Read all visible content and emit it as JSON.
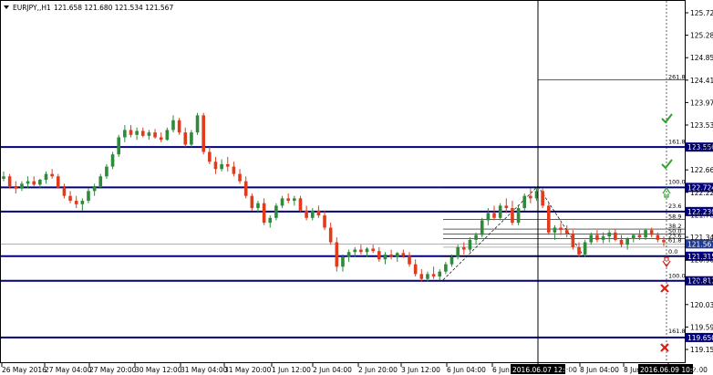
{
  "header": {
    "symbol": "EURJPY,,H1",
    "ohlc": "121.658 121.680 121.534 121.567"
  },
  "colors": {
    "axis": "#000000",
    "level_line": "#000080",
    "bull": "#2e8b3a",
    "bear": "#e23b1c",
    "price_tag": "#000080",
    "current_tag": "#1f3a93",
    "check": "#2aa52a",
    "cross": "#d9231a"
  },
  "chart_data": {
    "type": "candlestick",
    "ylim": [
      119.2,
      126.3
    ],
    "y_ticks": [
      "125.720",
      "125.280",
      "124.850",
      "124.410",
      "123.970",
      "123.530",
      "123.090",
      "122.660",
      "122.220",
      "121.780",
      "121.340",
      "120.900",
      "120.470",
      "120.030",
      "119.590",
      "119.150"
    ],
    "x_ticks": [
      "26 May 2016",
      "27 May 04:00",
      "27 May 20:00",
      "30 May 12:00",
      "31 May 04:00",
      "31 May 20:00",
      "1 Jun 12:00",
      "2 Jun 04:00",
      "2 Jun 20:00",
      "3 Jun 12:00",
      "6 Jun 04:00",
      "6 Jun 20:00",
      "7 Jun 12:00",
      "8 Jun 04:00",
      "8 Jun 20:00",
      "9 Jun 12:00"
    ],
    "cursor_x_label": "2016.06.07 12:00",
    "cursor_x_label_right": "2016.06.09 10:00",
    "levels": [
      {
        "price": "123.550",
        "value": 123.55
      },
      {
        "price": "122.724",
        "value": 122.724
      },
      {
        "price": "122.230",
        "value": 122.23
      },
      {
        "price": "121.315",
        "value": 121.315
      },
      {
        "price": "120.812",
        "value": 120.812
      },
      {
        "price": "119.650",
        "value": 119.65
      }
    ],
    "current_price": {
      "price": "121.567",
      "value": 121.567
    },
    "fib_labels": [
      {
        "text": "261.8",
        "value": 124.93
      },
      {
        "text": "161.8",
        "value": 123.6
      },
      {
        "text": "100.0",
        "value": 122.78
      },
      {
        "text": "23.6",
        "value": 122.28
      },
      {
        "text": "58.9",
        "value": 122.07
      },
      {
        "text": "38.2",
        "value": 121.87
      },
      {
        "text": "50.0",
        "value": 121.77
      },
      {
        "text": "23.6",
        "value": 121.68
      },
      {
        "text": "61.8",
        "value": 121.58
      },
      {
        "text": "0.0",
        "value": 121.35
      },
      {
        "text": "100.0",
        "value": 120.85
      },
      {
        "text": "161.8",
        "value": 119.72
      }
    ],
    "candles": [
      [
        122.9,
        123.05,
        122.85,
        122.95
      ],
      [
        122.95,
        123.0,
        122.7,
        122.75
      ],
      [
        122.75,
        122.85,
        122.6,
        122.7
      ],
      [
        122.7,
        122.85,
        122.65,
        122.8
      ],
      [
        122.8,
        122.95,
        122.7,
        122.85
      ],
      [
        122.85,
        122.95,
        122.75,
        122.78
      ],
      [
        122.78,
        122.9,
        122.7,
        122.88
      ],
      [
        122.88,
        123.05,
        122.8,
        123.0
      ],
      [
        123.0,
        123.1,
        122.9,
        122.95
      ],
      [
        122.95,
        123.0,
        122.7,
        122.72
      ],
      [
        122.72,
        122.8,
        122.5,
        122.55
      ],
      [
        122.55,
        122.65,
        122.4,
        122.45
      ],
      [
        122.45,
        122.55,
        122.3,
        122.38
      ],
      [
        122.38,
        122.5,
        122.25,
        122.45
      ],
      [
        122.45,
        122.7,
        122.4,
        122.65
      ],
      [
        122.65,
        122.8,
        122.55,
        122.75
      ],
      [
        122.75,
        123.0,
        122.7,
        122.95
      ],
      [
        122.95,
        123.2,
        122.9,
        123.15
      ],
      [
        123.15,
        123.45,
        123.1,
        123.4
      ],
      [
        123.4,
        123.8,
        123.35,
        123.75
      ],
      [
        123.75,
        124.0,
        123.65,
        123.9
      ],
      [
        123.9,
        124.0,
        123.75,
        123.8
      ],
      [
        123.8,
        123.95,
        123.7,
        123.88
      ],
      [
        123.88,
        123.95,
        123.75,
        123.78
      ],
      [
        123.78,
        123.9,
        123.7,
        123.85
      ],
      [
        123.85,
        123.92,
        123.72,
        123.75
      ],
      [
        123.75,
        123.85,
        123.65,
        123.7
      ],
      [
        123.7,
        123.95,
        123.68,
        123.9
      ],
      [
        123.9,
        124.2,
        123.85,
        124.1
      ],
      [
        124.1,
        124.15,
        123.8,
        123.85
      ],
      [
        123.85,
        123.95,
        123.55,
        123.6
      ],
      [
        123.6,
        123.9,
        123.55,
        123.85
      ],
      [
        123.85,
        124.25,
        123.8,
        124.2
      ],
      [
        124.2,
        124.25,
        123.4,
        123.45
      ],
      [
        123.45,
        123.55,
        123.2,
        123.25
      ],
      [
        123.25,
        123.35,
        123.0,
        123.1
      ],
      [
        123.1,
        123.3,
        123.05,
        123.2
      ],
      [
        123.2,
        123.35,
        123.05,
        123.15
      ],
      [
        123.15,
        123.25,
        122.95,
        123.0
      ],
      [
        123.0,
        123.1,
        122.8,
        122.85
      ],
      [
        122.85,
        122.95,
        122.5,
        122.55
      ],
      [
        122.55,
        122.6,
        122.25,
        122.3
      ],
      [
        122.3,
        122.45,
        122.2,
        122.4
      ],
      [
        122.4,
        122.5,
        121.95,
        122.0
      ],
      [
        122.0,
        122.15,
        121.9,
        122.1
      ],
      [
        122.1,
        122.4,
        122.05,
        122.35
      ],
      [
        122.35,
        122.55,
        122.3,
        122.5
      ],
      [
        122.5,
        122.6,
        122.4,
        122.45
      ],
      [
        122.45,
        122.55,
        122.35,
        122.5
      ],
      [
        122.5,
        122.55,
        122.2,
        122.25
      ],
      [
        122.25,
        122.35,
        122.05,
        122.1
      ],
      [
        122.1,
        122.3,
        122.05,
        122.25
      ],
      [
        122.25,
        122.35,
        122.1,
        122.15
      ],
      [
        122.15,
        122.25,
        121.85,
        121.9
      ],
      [
        121.9,
        122.0,
        121.55,
        121.6
      ],
      [
        121.6,
        121.7,
        121.0,
        121.1
      ],
      [
        121.1,
        121.35,
        121.0,
        121.3
      ],
      [
        121.3,
        121.45,
        121.2,
        121.4
      ],
      [
        121.4,
        121.5,
        121.3,
        121.45
      ],
      [
        121.45,
        121.55,
        121.35,
        121.4
      ],
      [
        121.4,
        121.5,
        121.3,
        121.47
      ],
      [
        121.47,
        121.55,
        121.38,
        121.42
      ],
      [
        121.42,
        121.5,
        121.2,
        121.25
      ],
      [
        121.25,
        121.4,
        121.15,
        121.35
      ],
      [
        121.35,
        121.45,
        121.25,
        121.3
      ],
      [
        121.3,
        121.4,
        121.2,
        121.38
      ],
      [
        121.38,
        121.45,
        121.28,
        121.32
      ],
      [
        121.32,
        121.4,
        121.1,
        121.15
      ],
      [
        121.15,
        121.25,
        120.9,
        120.95
      ],
      [
        120.95,
        121.05,
        120.8,
        120.85
      ],
      [
        120.85,
        121.0,
        120.8,
        120.95
      ],
      [
        120.95,
        121.1,
        120.85,
        120.9
      ],
      [
        120.9,
        121.05,
        120.82,
        121.0
      ],
      [
        121.0,
        121.2,
        120.95,
        121.15
      ],
      [
        121.15,
        121.35,
        121.1,
        121.3
      ],
      [
        121.3,
        121.55,
        121.25,
        121.5
      ],
      [
        121.5,
        121.6,
        121.35,
        121.45
      ],
      [
        121.45,
        121.7,
        121.4,
        121.65
      ],
      [
        121.65,
        121.8,
        121.55,
        121.75
      ],
      [
        121.75,
        122.1,
        121.7,
        122.05
      ],
      [
        122.05,
        122.3,
        121.95,
        122.2
      ],
      [
        122.2,
        122.35,
        122.05,
        122.1
      ],
      [
        122.1,
        122.4,
        122.05,
        122.35
      ],
      [
        122.35,
        122.5,
        122.2,
        122.3
      ],
      [
        122.3,
        122.45,
        121.95,
        122.0
      ],
      [
        122.0,
        122.35,
        121.95,
        122.3
      ],
      [
        122.3,
        122.6,
        122.25,
        122.55
      ],
      [
        122.55,
        122.7,
        122.4,
        122.5
      ],
      [
        122.5,
        122.72,
        122.45,
        122.65
      ],
      [
        122.65,
        122.7,
        122.3,
        122.35
      ],
      [
        122.35,
        122.4,
        121.75,
        121.8
      ],
      [
        121.8,
        121.95,
        121.65,
        121.9
      ],
      [
        121.9,
        122.0,
        121.75,
        121.85
      ],
      [
        121.85,
        121.95,
        121.7,
        121.78
      ],
      [
        121.78,
        121.85,
        121.45,
        121.5
      ],
      [
        121.5,
        121.6,
        121.3,
        121.35
      ],
      [
        121.35,
        121.65,
        121.3,
        121.6
      ],
      [
        121.6,
        121.8,
        121.55,
        121.75
      ],
      [
        121.75,
        121.85,
        121.6,
        121.65
      ],
      [
        121.65,
        121.8,
        121.58,
        121.72
      ],
      [
        121.72,
        121.85,
        121.6,
        121.8
      ],
      [
        121.8,
        121.88,
        121.62,
        121.65
      ],
      [
        121.65,
        121.75,
        121.5,
        121.55
      ],
      [
        121.55,
        121.7,
        121.45,
        121.68
      ],
      [
        121.68,
        121.78,
        121.6,
        121.75
      ],
      [
        121.75,
        121.85,
        121.65,
        121.7
      ],
      [
        121.7,
        121.88,
        121.65,
        121.85
      ],
      [
        121.85,
        121.9,
        121.7,
        121.75
      ],
      [
        121.75,
        121.8,
        121.6,
        121.65
      ],
      [
        121.65,
        121.72,
        121.52,
        121.6
      ]
    ]
  }
}
